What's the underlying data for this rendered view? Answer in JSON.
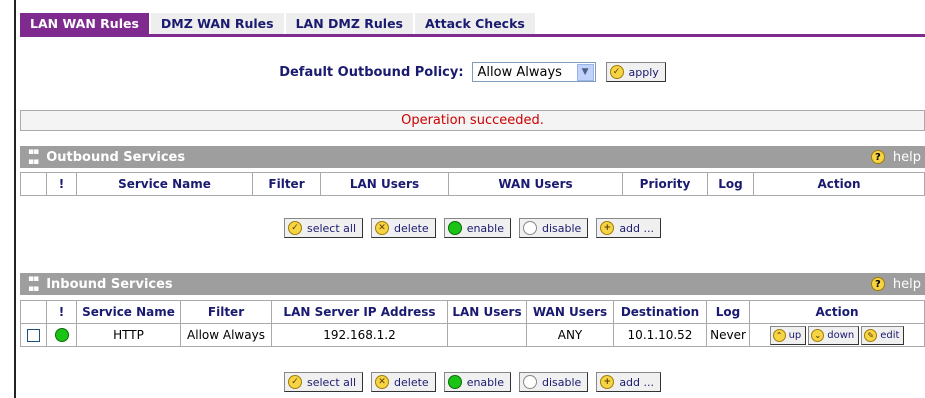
{
  "tabs": [
    {
      "label": "LAN WAN Rules",
      "active": true
    },
    {
      "label": "DMZ WAN Rules",
      "active": false
    },
    {
      "label": "LAN DMZ Rules",
      "active": false
    },
    {
      "label": "Attack Checks",
      "active": false
    }
  ],
  "policy": {
    "label": "Default Outbound Policy:",
    "selected": "Allow Always",
    "apply_label": "apply"
  },
  "status_message": "Operation succeeded.",
  "outbound": {
    "title": "Outbound Services",
    "help_label": "help",
    "columns": [
      "!",
      "Service Name",
      "Filter",
      "LAN Users",
      "WAN Users",
      "Priority",
      "Log",
      "Action"
    ]
  },
  "inbound": {
    "title": "Inbound Services",
    "help_label": "help",
    "columns": [
      "!",
      "Service Name",
      "Filter",
      "LAN Server IP Address",
      "LAN Users",
      "WAN Users",
      "Destination",
      "Log",
      "Action"
    ],
    "rows": [
      {
        "service": "HTTP",
        "filter": "Allow Always",
        "server_ip": "192.168.1.2",
        "lan_users": "",
        "wan_users": "ANY",
        "destination": "10.1.10.52",
        "log": "Never",
        "up": "up",
        "down": "down",
        "edit": "edit"
      }
    ]
  },
  "buttons": {
    "select_all": "select all",
    "delete": "delete",
    "enable": "enable",
    "disable": "disable",
    "add": "add ..."
  },
  "colors": {
    "accent": "#7f2a8f",
    "header_bar": "#9e9e9e",
    "status_text": "#cc0000",
    "enabled_dot": "#19c414"
  }
}
